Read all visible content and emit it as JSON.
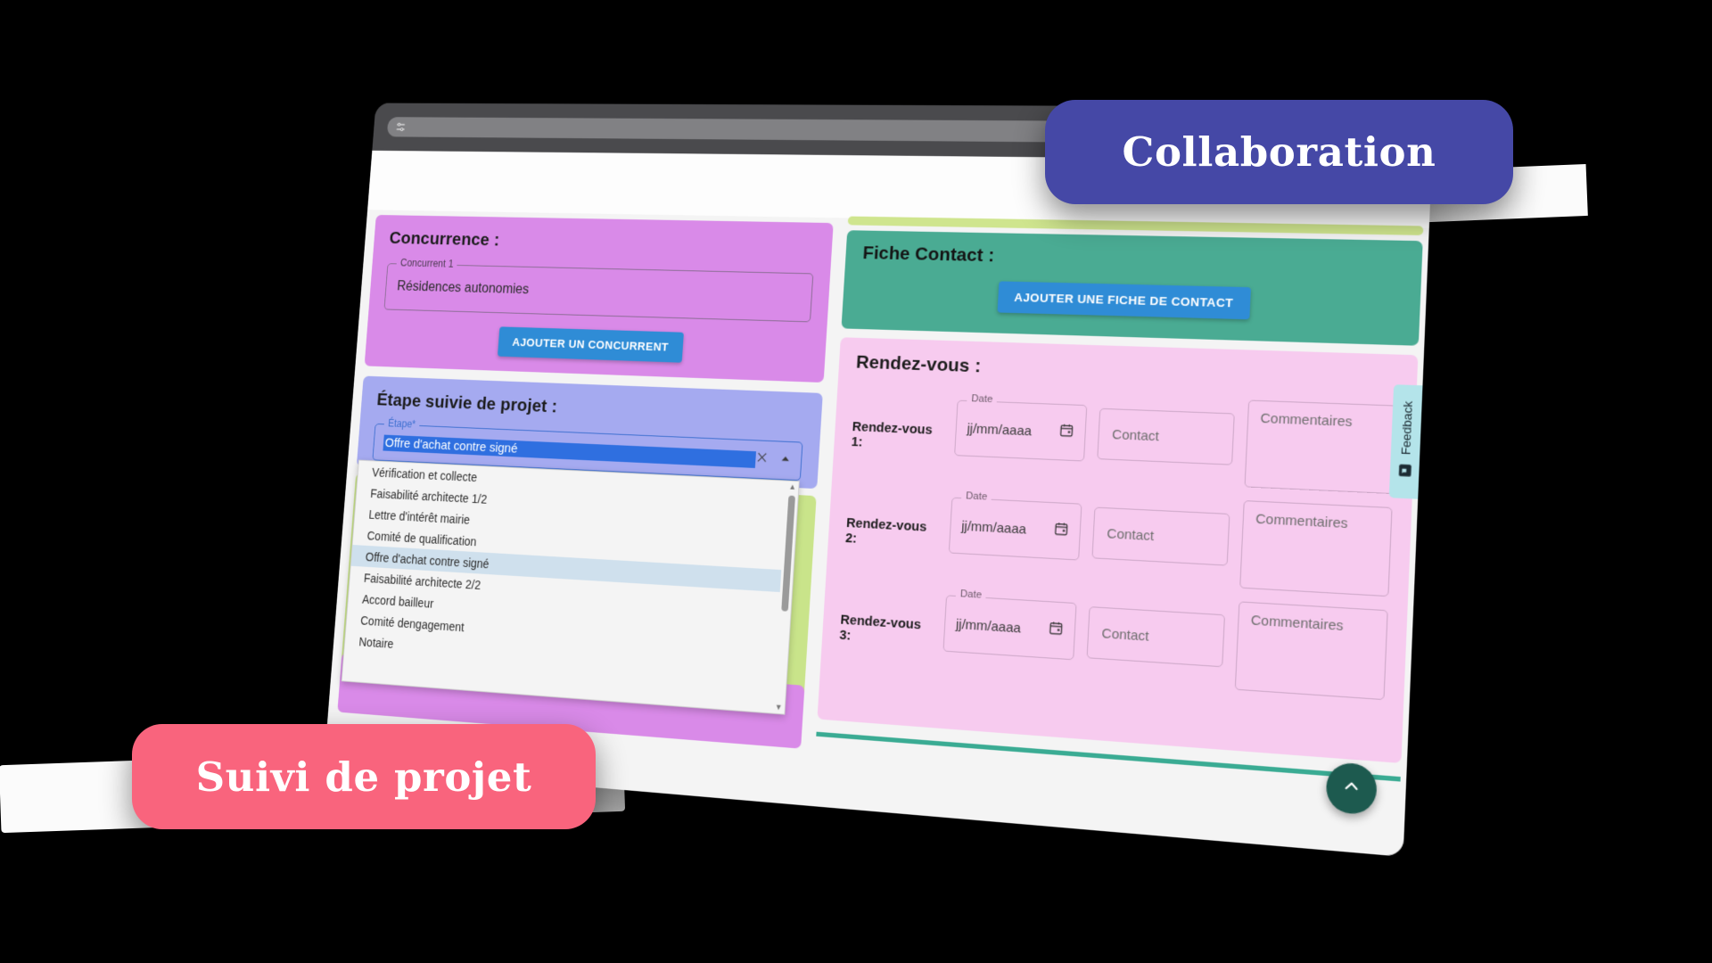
{
  "browser": {
    "url_value": "",
    "icons": {
      "sliders": "sliders-icon",
      "search": "search-icon",
      "home": "home-icon"
    }
  },
  "left_column": {
    "concurrence": {
      "title": "Concurrence :",
      "field_label": "Concurrent 1",
      "field_value": "Résidences autonomies",
      "add_button": "AJOUTER UN CONCURRENT"
    },
    "etape": {
      "title": "Étape suivie de projet :",
      "field_label": "Étape*",
      "selected_value": "Offre d'achat contre signé",
      "clear_icon": "close-icon",
      "toggle_icon": "chevron-up-icon",
      "options": [
        "Vérification et collecte",
        "Faisabilité architecte 1/2",
        "Lettre d'intérêt mairie",
        "Comité de qualification",
        "Offre d'achat contre signé",
        "Faisabilité architecte 2/2",
        "Accord bailleur",
        "Comité dengagement",
        "Notaire"
      ],
      "selected_index": 4
    }
  },
  "right_column": {
    "fiche_contact": {
      "title": "Fiche Contact :",
      "add_button": "AJOUTER UNE FICHE DE CONTACT"
    },
    "rendez_vous": {
      "title": "Rendez-vous :",
      "date_label": "Date",
      "date_placeholder": "jj/mm/aaaa",
      "contact_placeholder": "Contact",
      "comments_placeholder": "Commentaires",
      "calendar_icon": "calendar-icon",
      "rows": [
        {
          "label": "Rendez-vous 1:"
        },
        {
          "label": "Rendez-vous 2:"
        },
        {
          "label": "Rendez-vous 3:"
        }
      ]
    }
  },
  "feedback_tab": {
    "label": "Feedback",
    "icon": "feedback-icon"
  },
  "scroll_top_button": {
    "icon": "chevron-up-icon"
  },
  "badges": {
    "collaboration": "Collaboration",
    "suivi": "Suivi de projet"
  },
  "colors": {
    "accent_blue": "#2f8cd6",
    "concurrence_panel": "#d98ae8",
    "etape_panel": "#a5aaf0",
    "green_panel": "#c9e48a",
    "fiche_panel": "#4aab93",
    "rdv_panel": "#f7cbef",
    "feedback_tab": "#b4e4ea",
    "fab": "#1d5a4f",
    "badge_collaboration": "#4548a6",
    "badge_suivi": "#f9647d",
    "lime_strip": "#cfe58e",
    "teal_line": "#3aab93"
  }
}
